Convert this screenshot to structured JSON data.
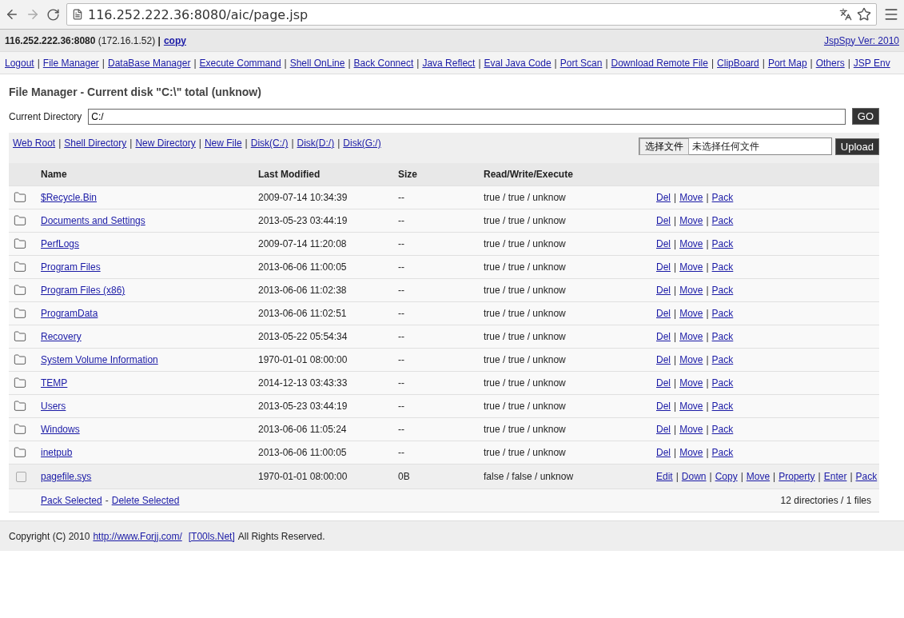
{
  "browser": {
    "url": "116.252.222.36:8080/aic/page.jsp"
  },
  "header": {
    "server": "**116.252.222.36:8080** (172.16.1.52) **|**",
    "copy": "copy",
    "version": "JspSpy Ver: 2010"
  },
  "nav": {
    "separator": "|",
    "links": [
      "Logout",
      "File Manager",
      "DataBase Manager",
      "Execute Command",
      "Shell OnLine",
      "Back Connect",
      "Java Reflect",
      "Eval Java Code",
      "Port Scan",
      "Download Remote File",
      "ClipBoard",
      "Port Map",
      "Others",
      "JSP Env"
    ]
  },
  "title": "File Manager - Current disk \"C:\\\" total (unknow)",
  "directory": {
    "label": "Current Directory",
    "value": "C:/",
    "button": "GO"
  },
  "quick_links": [
    "Web Root",
    "Shell Directory",
    "New Directory",
    "New File",
    "Disk(C:/)",
    "Disk(D:/)",
    "Disk(G:/)"
  ],
  "upload": {
    "choose": "选择文件",
    "status": "未选择任何文件",
    "button": "Upload"
  },
  "table": {
    "columns": [
      "Name",
      "Last Modified",
      "Size",
      "Read/Write/Execute"
    ],
    "rows": [
      {
        "kind": "dir",
        "name": "$Recycle.Bin",
        "modified": "2009-07-14 10:34:39",
        "size": "--",
        "rwx": "true / true / unknow",
        "actions": [
          "Del",
          "Move",
          "Pack"
        ]
      },
      {
        "kind": "dir",
        "name": "Documents and Settings",
        "modified": "2013-05-23 03:44:19",
        "size": "--",
        "rwx": "true / true / unknow",
        "actions": [
          "Del",
          "Move",
          "Pack"
        ]
      },
      {
        "kind": "dir",
        "name": "PerfLogs",
        "modified": "2009-07-14 11:20:08",
        "size": "--",
        "rwx": "true / true / unknow",
        "actions": [
          "Del",
          "Move",
          "Pack"
        ]
      },
      {
        "kind": "dir",
        "name": "Program Files",
        "modified": "2013-06-06 11:00:05",
        "size": "--",
        "rwx": "true / true / unknow",
        "actions": [
          "Del",
          "Move",
          "Pack"
        ]
      },
      {
        "kind": "dir",
        "name": "Program Files (x86)",
        "modified": "2013-06-06 11:02:38",
        "size": "--",
        "rwx": "true / true / unknow",
        "actions": [
          "Del",
          "Move",
          "Pack"
        ]
      },
      {
        "kind": "dir",
        "name": "ProgramData",
        "modified": "2013-06-06 11:02:51",
        "size": "--",
        "rwx": "true / true / unknow",
        "actions": [
          "Del",
          "Move",
          "Pack"
        ]
      },
      {
        "kind": "dir",
        "name": "Recovery",
        "modified": "2013-05-22 05:54:34",
        "size": "--",
        "rwx": "true / true / unknow",
        "actions": [
          "Del",
          "Move",
          "Pack"
        ]
      },
      {
        "kind": "dir",
        "name": "System Volume Information",
        "modified": "1970-01-01 08:00:00",
        "size": "--",
        "rwx": "true / true / unknow",
        "actions": [
          "Del",
          "Move",
          "Pack"
        ]
      },
      {
        "kind": "dir",
        "name": "TEMP",
        "modified": "2014-12-13 03:43:33",
        "size": "--",
        "rwx": "true / true / unknow",
        "actions": [
          "Del",
          "Move",
          "Pack"
        ]
      },
      {
        "kind": "dir",
        "name": "Users",
        "modified": "2013-05-23 03:44:19",
        "size": "--",
        "rwx": "true / true / unknow",
        "actions": [
          "Del",
          "Move",
          "Pack"
        ]
      },
      {
        "kind": "dir",
        "name": "Windows",
        "modified": "2013-06-06 11:05:24",
        "size": "--",
        "rwx": "true / true / unknow",
        "actions": [
          "Del",
          "Move",
          "Pack"
        ]
      },
      {
        "kind": "dir",
        "name": "inetpub",
        "modified": "2013-06-06 11:00:05",
        "size": "--",
        "rwx": "true / true / unknow",
        "actions": [
          "Del",
          "Move",
          "Pack"
        ]
      },
      {
        "kind": "file",
        "checked": false,
        "name": "pagefile.sys",
        "modified": "1970-01-01 08:00:00",
        "size": "0B",
        "rwx": "false / false / unknow",
        "actions": [
          "Edit",
          "Down",
          "Copy",
          "Move",
          "Property",
          "Enter",
          "Pack"
        ]
      }
    ],
    "footer": {
      "pack": "Pack Selected",
      "joiner": "-",
      "delete": "Delete Selected",
      "summary": "12 directories / 1 files"
    }
  },
  "copyright": {
    "text": "Copyright (C) 2010",
    "link1": "http://www.Forjj.com/",
    "link2": "[T00ls.Net]",
    "rest": "All Rights Reserved."
  }
}
